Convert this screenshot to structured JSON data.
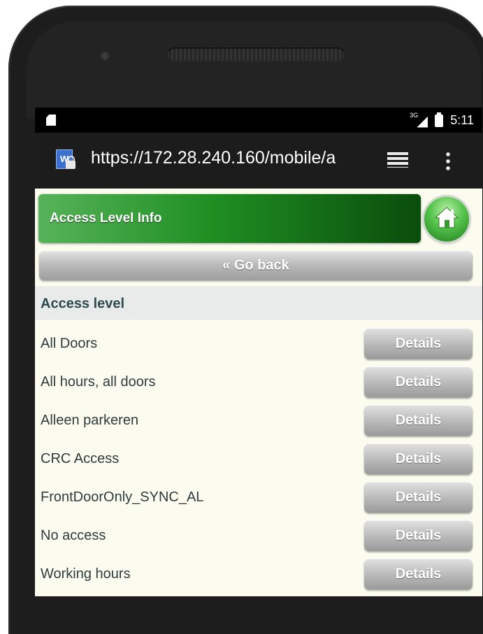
{
  "status_bar": {
    "network": "3G",
    "time": "5:11"
  },
  "browser": {
    "url": "https://172.28.240.160/mobile/a",
    "site_icon_letter": "W"
  },
  "header": {
    "title": "Access Level Info"
  },
  "back_button": {
    "label": "« Go back"
  },
  "section": {
    "title": "Access level"
  },
  "access_levels": [
    {
      "name": "All Doors",
      "action": "Details"
    },
    {
      "name": "All hours, all doors",
      "action": "Details"
    },
    {
      "name": "Alleen parkeren",
      "action": "Details"
    },
    {
      "name": "CRC Access",
      "action": "Details"
    },
    {
      "name": "FrontDoorOnly_SYNC_AL",
      "action": "Details"
    },
    {
      "name": "No access",
      "action": "Details"
    },
    {
      "name": "Working hours",
      "action": "Details"
    }
  ],
  "colors": {
    "header_green": "#1f8f22",
    "page_background": "#fbfcef",
    "button_gray": "#bcbcbc"
  }
}
